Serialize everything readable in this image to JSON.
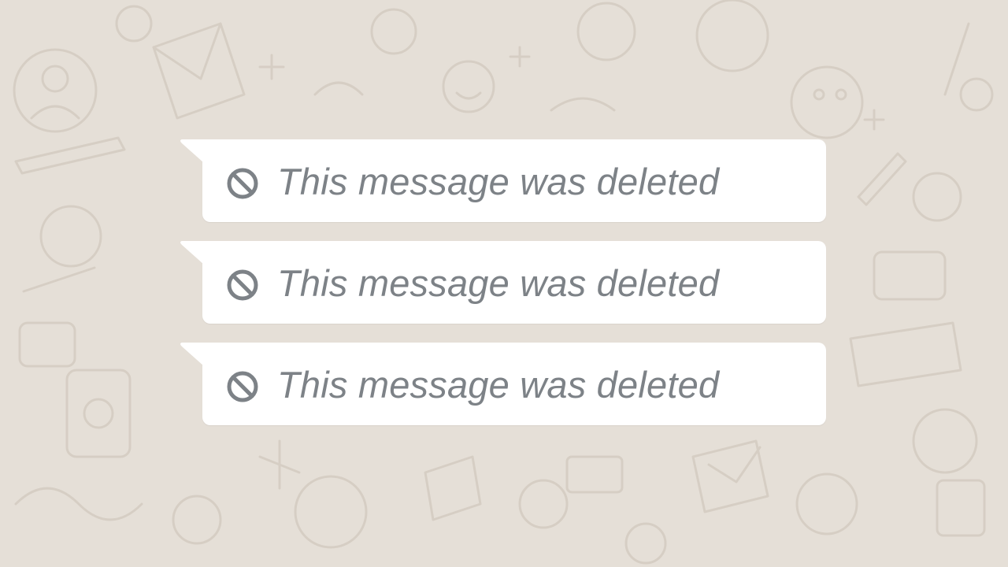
{
  "colors": {
    "wallpaper": "#e5dfd7",
    "wallpaper_doodle": "#d7cfc5",
    "bubble": "#ffffff",
    "deleted_text": "#7d8287"
  },
  "messages": [
    {
      "text": "This message was deleted",
      "icon": "deleted-message-icon"
    },
    {
      "text": "This message was deleted",
      "icon": "deleted-message-icon"
    },
    {
      "text": "This message was deleted",
      "icon": "deleted-message-icon"
    }
  ]
}
